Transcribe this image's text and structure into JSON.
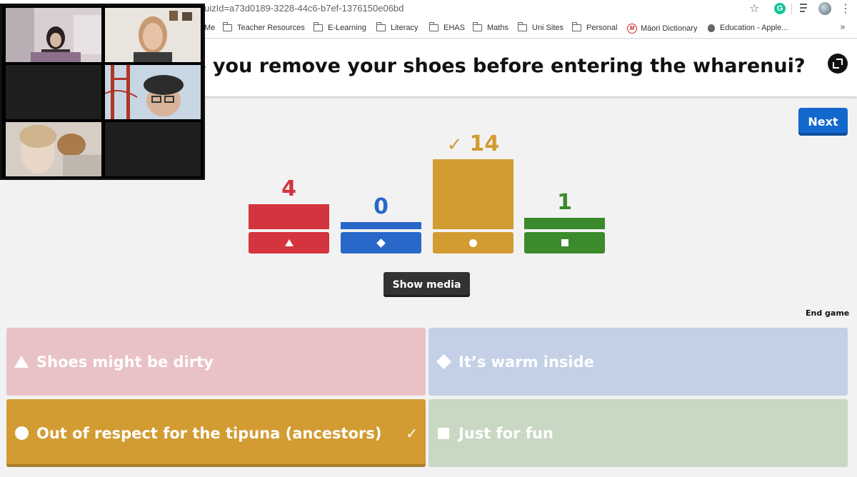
{
  "browser": {
    "url": "uizId=a73d0189-3228-44c6-b7ef-1376150e06bd",
    "bookmarks": [
      {
        "label": "Me",
        "icon": "folder-icon"
      },
      {
        "label": "Teacher Resources",
        "icon": "folder-icon"
      },
      {
        "label": "E-Learning",
        "icon": "folder-icon"
      },
      {
        "label": "Literacy",
        "icon": "folder-icon"
      },
      {
        "label": "EHAS",
        "icon": "folder-icon"
      },
      {
        "label": "Maths",
        "icon": "folder-icon"
      },
      {
        "label": "Uni Sites",
        "icon": "folder-icon"
      },
      {
        "label": "Personal",
        "icon": "folder-icon"
      },
      {
        "label": "Māori Dictionary",
        "icon": "maori-dictionary-icon"
      },
      {
        "label": "Education - Apple...",
        "icon": "apple-icon"
      }
    ],
    "more": "»",
    "grammarly_letter": "G"
  },
  "question": {
    "title": "o you remove your shoes before entering the wharenui?"
  },
  "buttons": {
    "next": "Next",
    "show_media": "Show media",
    "end_game": "End game"
  },
  "chart_data": {
    "type": "bar",
    "categories": [
      "triangle",
      "diamond",
      "circle",
      "square"
    ],
    "values": [
      4,
      0,
      14,
      1
    ],
    "correct": [
      false,
      false,
      true,
      false
    ],
    "colors": [
      "#d4343d",
      "#2868c9",
      "#d29c32",
      "#3b8a2b"
    ],
    "ylim": [
      0,
      14
    ]
  },
  "answers": [
    {
      "text": "Shoes might be dirty",
      "shape": "triangle",
      "color": "#e9c2c6",
      "correct": false
    },
    {
      "text": "It’s warm inside",
      "shape": "diamond",
      "color": "#c4d0e6",
      "correct": false
    },
    {
      "text": "Out of respect for the tipuna (ancestors)",
      "shape": "circle",
      "color": "#d29c32",
      "correct": true,
      "check": "✓"
    },
    {
      "text": "Just for fun",
      "shape": "square",
      "color": "#c9d8c2",
      "correct": false
    }
  ],
  "video_call": {
    "tiles": [
      "participant-1",
      "participant-2",
      "participant-3",
      "participant-4",
      "participant-5",
      "participant-6"
    ]
  }
}
